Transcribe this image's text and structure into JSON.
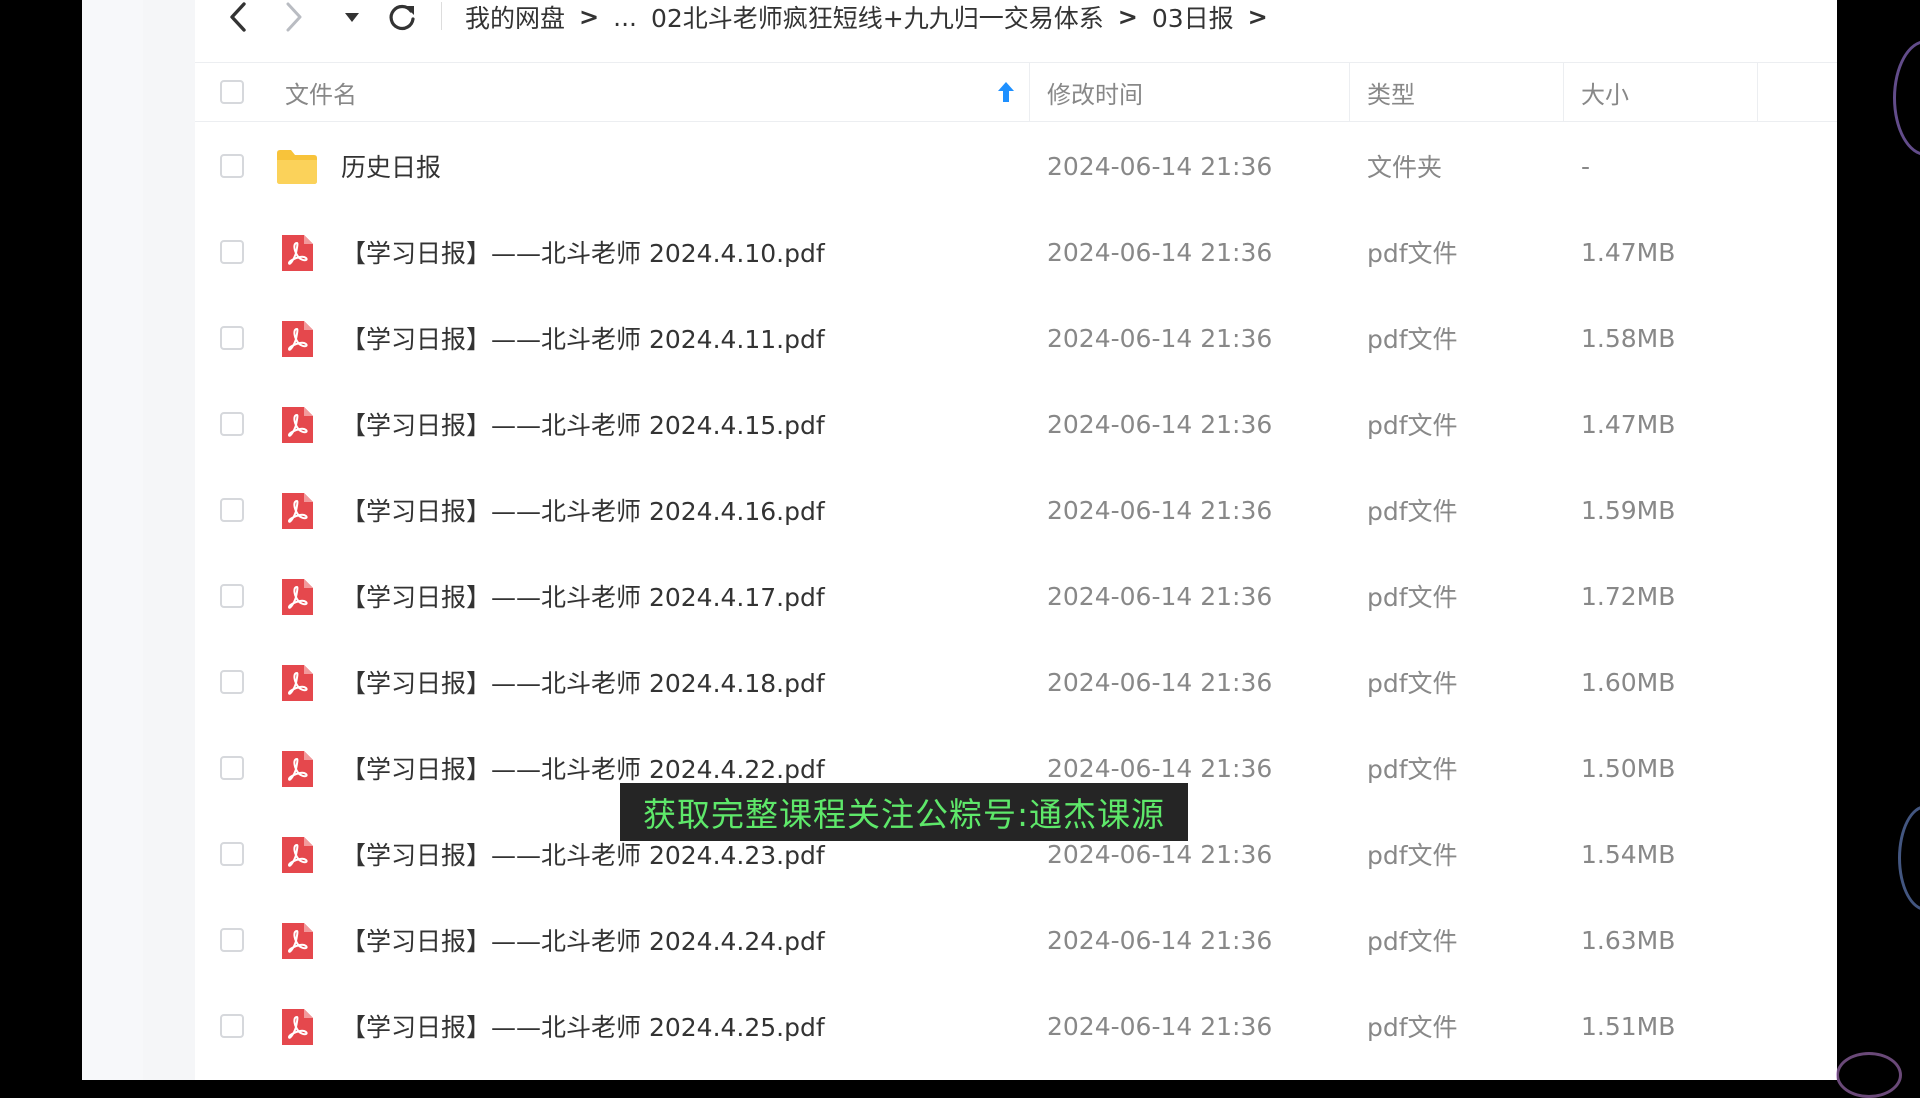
{
  "toolbar": {
    "back_icon": "chevron-left-icon",
    "forward_icon": "chevron-right-icon",
    "dropdown_icon": "caret-down-icon",
    "refresh_icon": "refresh-icon"
  },
  "breadcrumb": {
    "items": [
      "我的网盘",
      "...",
      "02北斗老师疯狂短线+九九归一交易体系",
      "03日报"
    ],
    "separator": ">"
  },
  "columns": {
    "name": "文件名",
    "modified": "修改时间",
    "type": "类型",
    "size": "大小",
    "sort_icon": "arrow-up-icon",
    "sort_color": "#1e90ff"
  },
  "files": [
    {
      "icon": "folder-icon",
      "name": "历史日报",
      "modified": "2024-06-14 21:36",
      "type": "文件夹",
      "size": "-"
    },
    {
      "icon": "pdf-icon",
      "name": "【学习日报】——北斗老师  2024.4.10.pdf",
      "modified": "2024-06-14 21:36",
      "type": "pdf文件",
      "size": "1.47MB"
    },
    {
      "icon": "pdf-icon",
      "name": "【学习日报】——北斗老师  2024.4.11.pdf",
      "modified": "2024-06-14 21:36",
      "type": "pdf文件",
      "size": "1.58MB"
    },
    {
      "icon": "pdf-icon",
      "name": "【学习日报】——北斗老师  2024.4.15.pdf",
      "modified": "2024-06-14 21:36",
      "type": "pdf文件",
      "size": "1.47MB"
    },
    {
      "icon": "pdf-icon",
      "name": "【学习日报】——北斗老师  2024.4.16.pdf",
      "modified": "2024-06-14 21:36",
      "type": "pdf文件",
      "size": "1.59MB"
    },
    {
      "icon": "pdf-icon",
      "name": "【学习日报】——北斗老师  2024.4.17.pdf",
      "modified": "2024-06-14 21:36",
      "type": "pdf文件",
      "size": "1.72MB"
    },
    {
      "icon": "pdf-icon",
      "name": "【学习日报】——北斗老师  2024.4.18.pdf",
      "modified": "2024-06-14 21:36",
      "type": "pdf文件",
      "size": "1.60MB"
    },
    {
      "icon": "pdf-icon",
      "name": "【学习日报】——北斗老师  2024.4.22.pdf",
      "modified": "2024-06-14 21:36",
      "type": "pdf文件",
      "size": "1.50MB"
    },
    {
      "icon": "pdf-icon",
      "name": "【学习日报】——北斗老师  2024.4.23.pdf",
      "modified": "2024-06-14 21:36",
      "type": "pdf文件",
      "size": "1.54MB"
    },
    {
      "icon": "pdf-icon",
      "name": "【学习日报】——北斗老师  2024.4.24.pdf",
      "modified": "2024-06-14 21:36",
      "type": "pdf文件",
      "size": "1.63MB"
    },
    {
      "icon": "pdf-icon",
      "name": "【学习日报】——北斗老师  2024.4.25.pdf",
      "modified": "2024-06-14 21:36",
      "type": "pdf文件",
      "size": "1.51MB"
    }
  ],
  "overlay": {
    "subtitle": "获取完整课程关注公粽号:通杰课源",
    "subtitle_color": "#5ee86a"
  },
  "colors": {
    "folder": "#f8c33a",
    "pdf": "#e5484d"
  }
}
